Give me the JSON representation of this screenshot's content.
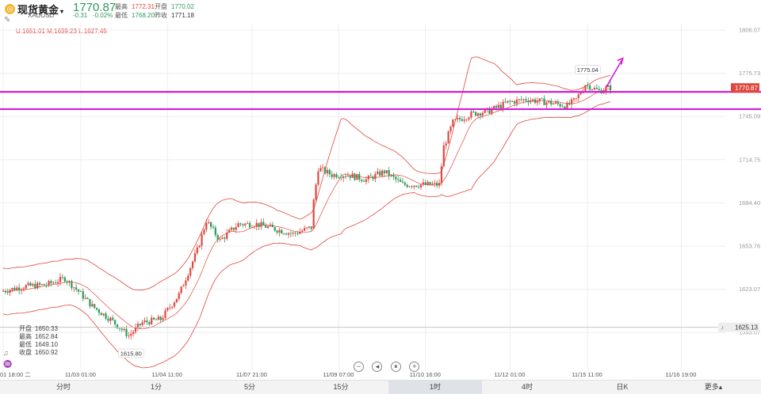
{
  "header": {
    "logo_glyph": "◎",
    "title": "现货黄金",
    "title_caret": "▾",
    "symbol": "XAUUSD",
    "price": "1770.87",
    "change": "-0.31",
    "change_pct": "-0.02%",
    "stats": {
      "high_label": "最高",
      "high_value": "1772.31",
      "open_label": "开盘",
      "open_value": "1770.02",
      "low_label": "最低",
      "low_value": "1768.20",
      "prev_label": "昨收",
      "prev_value": "1771.18"
    },
    "tool_icon": "✎"
  },
  "indicator": {
    "text": "U:1651.01  M:1639.23  L:1627.45"
  },
  "ohlc": {
    "open_label": "开盘",
    "open_value": "1650.33",
    "high_label": "最高",
    "high_value": "1652.84",
    "low_label": "最低",
    "low_value": "1649.10",
    "close_label": "收盘",
    "close_value": "1650.92"
  },
  "left_icons": [
    "♫",
    "♒",
    "↔"
  ],
  "zoom": {
    "minus": "−",
    "prev": "◂",
    "pause": "⏸",
    "plus": "+"
  },
  "tabs": [
    {
      "label": "分时"
    },
    {
      "label": "1分"
    },
    {
      "label": "5分"
    },
    {
      "label": "15分"
    },
    {
      "label": "1时",
      "active": true
    },
    {
      "label": "4时"
    },
    {
      "label": "日K"
    },
    {
      "label": "更多▴"
    }
  ],
  "colors": {
    "up": "#e0473e",
    "down": "#2d9a5c",
    "band": "#e0473e",
    "level_line": "#d11fd6",
    "grid": "#eeeeee",
    "arrow": "#d11fd6"
  },
  "chart_data": {
    "type": "candlestick",
    "ylim": [
      1598,
      1810
    ],
    "y_ticks": [
      "1806.07",
      "1775.73",
      "1745.09",
      "1714.75",
      "1684.40",
      "1653.76",
      "1623.07",
      "1593.07"
    ],
    "x_ticks": [
      "01 18:00 二",
      "11/03 01:00",
      "11/04 11:00",
      "11/07 21:00",
      "11/09 07:00",
      "11/10 16:00",
      "11/12 01:00",
      "11/15 11:00",
      "11/16 19:00"
    ],
    "x_tick_positions": [
      0,
      34,
      72,
      109,
      147,
      185,
      222,
      256,
      297
    ],
    "current_price": {
      "label": "1770.87",
      "value": 1770.87
    },
    "alert_price": {
      "label": "1625.13",
      "value": 1625.13
    },
    "horizontal_levels": [
      1768.5,
      1758
    ],
    "annotations": [
      {
        "label": "1615.80",
        "index": 56,
        "value": 1615.8
      },
      {
        "label": "1775.04",
        "index": 256,
        "value": 1775.04
      }
    ],
    "projection_arrow": {
      "from": [
        264,
        1771
      ],
      "to": [
        269,
        1788
      ]
    },
    "anchors": [
      [
        0,
        1647
      ],
      [
        10,
        1650
      ],
      [
        20,
        1651
      ],
      [
        28,
        1655
      ],
      [
        34,
        1647
      ],
      [
        40,
        1638
      ],
      [
        48,
        1630
      ],
      [
        56,
        1620
      ],
      [
        62,
        1628
      ],
      [
        70,
        1630
      ],
      [
        78,
        1645
      ],
      [
        86,
        1672
      ],
      [
        90,
        1690
      ],
      [
        96,
        1678
      ],
      [
        104,
        1688
      ],
      [
        112,
        1688
      ],
      [
        120,
        1685
      ],
      [
        128,
        1682
      ],
      [
        136,
        1686
      ],
      [
        137,
        1702
      ],
      [
        139,
        1722
      ],
      [
        145,
        1718
      ],
      [
        152,
        1718
      ],
      [
        160,
        1715
      ],
      [
        168,
        1720
      ],
      [
        176,
        1712
      ],
      [
        184,
        1712
      ],
      [
        192,
        1712
      ],
      [
        194,
        1735
      ],
      [
        198,
        1750
      ],
      [
        206,
        1755
      ],
      [
        214,
        1757
      ],
      [
        222,
        1762
      ],
      [
        230,
        1764
      ],
      [
        240,
        1762
      ],
      [
        248,
        1760
      ],
      [
        252,
        1764
      ],
      [
        256,
        1773
      ],
      [
        262,
        1769
      ],
      [
        266,
        1771
      ]
    ],
    "band_widths": [
      [
        0,
        14
      ],
      [
        30,
        14
      ],
      [
        50,
        22
      ],
      [
        70,
        25
      ],
      [
        86,
        25
      ],
      [
        100,
        20
      ],
      [
        120,
        10
      ],
      [
        130,
        8
      ],
      [
        136,
        12
      ],
      [
        148,
        35
      ],
      [
        165,
        20
      ],
      [
        180,
        7
      ],
      [
        192,
        7
      ],
      [
        205,
        40
      ],
      [
        215,
        30
      ],
      [
        225,
        12
      ],
      [
        240,
        10
      ],
      [
        250,
        8
      ],
      [
        266,
        8
      ]
    ]
  }
}
